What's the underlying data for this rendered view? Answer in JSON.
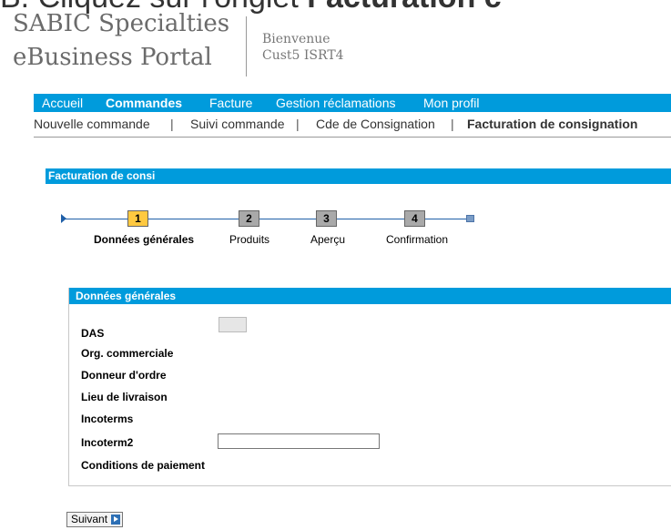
{
  "top_caption": {
    "prefix": "B. Cliquez sur l'onglet ",
    "bold": "Facturation c"
  },
  "brand": {
    "line1": "SABIC Specialties",
    "line2": "eBusiness Portal"
  },
  "welcome": {
    "greeting": "Bienvenue",
    "user": "Cust5 ISRT4"
  },
  "main_nav": [
    "Accueil",
    "Commandes",
    "Facture",
    "Gestion réclamations",
    "Mon profil"
  ],
  "main_nav_active": "Commandes",
  "sub_nav": [
    "Nouvelle commande",
    "Suivi commande",
    "Cde de Consignation",
    "Facturation de consignation"
  ],
  "sub_nav_active": "Facturation de consignation",
  "panel_title": "Facturation de consi",
  "wizard": {
    "steps": [
      {
        "num": "1",
        "label": "Données générales",
        "active": true
      },
      {
        "num": "2",
        "label": "Produits",
        "active": false
      },
      {
        "num": "3",
        "label": "Aperçu",
        "active": false
      },
      {
        "num": "4",
        "label": "Confirmation",
        "active": false
      }
    ]
  },
  "section": {
    "title": "Données générales",
    "fields": [
      "DAS",
      "Org. commerciale",
      "Donneur d'ordre",
      "Lieu de livraison",
      "Incoterms",
      "Incoterm2",
      "Conditions de paiement"
    ],
    "incoterm2_value": ""
  },
  "buttons": {
    "next": "Suivant"
  },
  "colors": {
    "accent": "#009bdc",
    "active_step": "#ffc940",
    "inactive_step": "#a9a9a9"
  }
}
